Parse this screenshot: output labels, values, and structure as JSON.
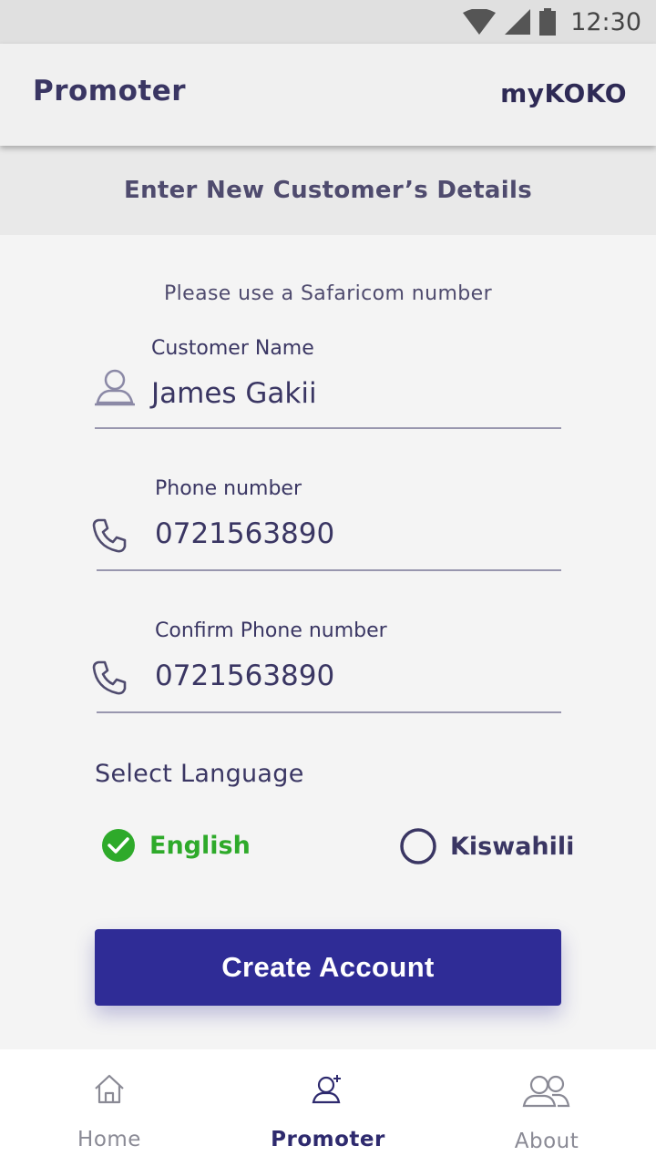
{
  "status_bar": {
    "time": "12:30",
    "icons": [
      "wifi-icon",
      "signal-icon",
      "battery-icon"
    ]
  },
  "app_bar": {
    "title": "Promoter",
    "brand": "myKOKO"
  },
  "section": {
    "title": "Enter New Customer’s Details"
  },
  "form": {
    "hint": "Please use a Safaricom number",
    "customer_name": {
      "label": "Customer Name",
      "value": "James Gakii",
      "icon": "person-icon"
    },
    "phone": {
      "label": "Phone number",
      "value": "0721563890",
      "icon": "phone-icon"
    },
    "confirm_phone": {
      "label": "Confirm Phone number",
      "value": "0721563890",
      "icon": "phone-icon"
    },
    "language": {
      "title": "Select Language",
      "options": [
        {
          "label": "English",
          "selected": true
        },
        {
          "label": "Kiswahili",
          "selected": false
        }
      ]
    },
    "submit_label": "Create Account"
  },
  "bottom_nav": {
    "items": [
      {
        "label": "Home",
        "icon": "home-icon",
        "active": false
      },
      {
        "label": "Promoter",
        "icon": "add-user-icon",
        "active": true
      },
      {
        "label": "About",
        "icon": "users-icon",
        "active": false
      }
    ]
  },
  "colors": {
    "accent": "#2f2c96",
    "selected": "#2eaa2a",
    "text": "#3a3663"
  }
}
